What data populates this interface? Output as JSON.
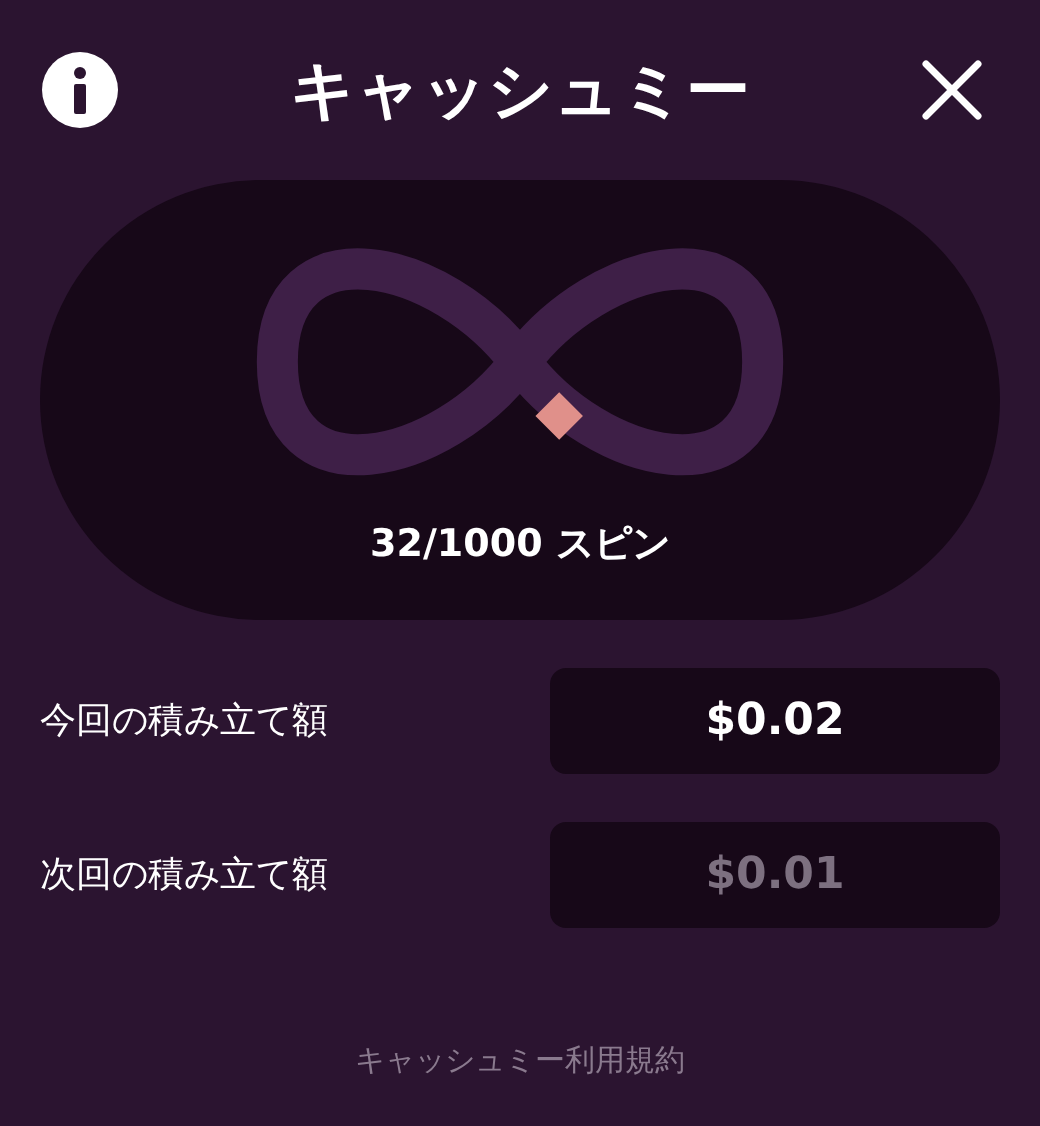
{
  "header": {
    "title": "キャッシュミー"
  },
  "progress": {
    "label": "32/1000 スピン"
  },
  "rows": [
    {
      "label": "今回の積み立て額",
      "value": "$0.02",
      "dimmed": false
    },
    {
      "label": "次回の積み立て額",
      "value": "$0.01",
      "dimmed": true
    }
  ],
  "footer": {
    "link": "キャッシュミー利用規約"
  }
}
